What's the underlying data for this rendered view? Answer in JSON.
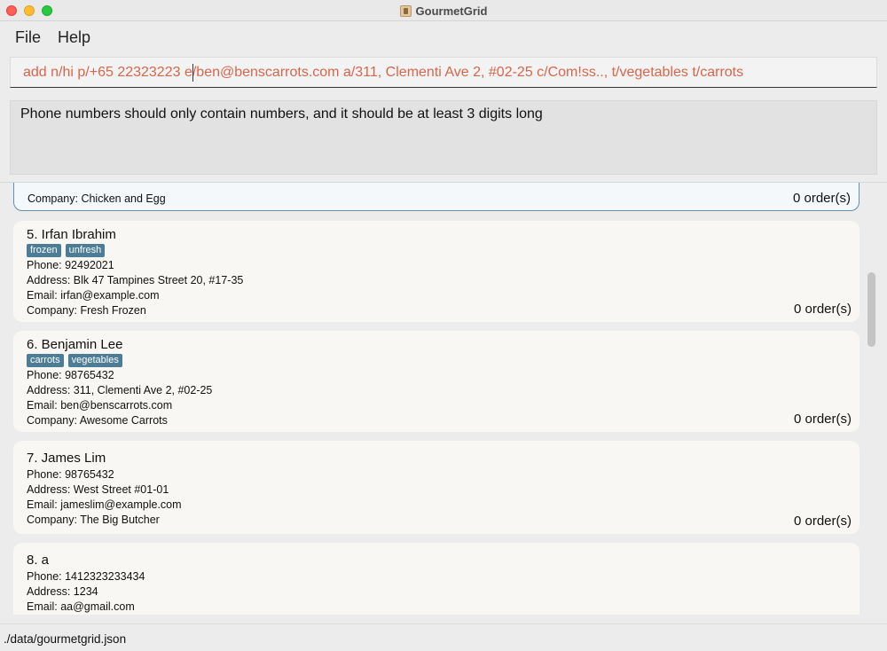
{
  "window": {
    "title": "GourmetGrid"
  },
  "menu": {
    "file": "File",
    "help": "Help"
  },
  "command": {
    "value": "add n/hi p/+65 22323223 e/ben@benscarrots.com a/311, Clementi Ave 2, #02-25 c/Com!ss.., t/vegetables t/carrots"
  },
  "result": {
    "message": "Phone numbers should only contain numbers, and it should be at least 3 digits long"
  },
  "contacts": {
    "c4": {
      "company": "Company: Chicken and Egg",
      "orders": "0 order(s)"
    },
    "c5": {
      "name": "5.  Irfan Ibrahim",
      "tags": [
        "frozen",
        "unfresh"
      ],
      "phone": "Phone: 92492021",
      "address": "Address: Blk 47 Tampines Street 20, #17-35",
      "email": "Email: irfan@example.com",
      "company": "Company: Fresh Frozen",
      "orders": "0 order(s)"
    },
    "c6": {
      "name": "6.  Benjamin Lee",
      "tags": [
        "carrots",
        "vegetables"
      ],
      "phone": "Phone: 98765432",
      "address": "Address: 311, Clementi Ave 2, #02-25",
      "email": "Email: ben@benscarrots.com",
      "company": "Company: Awesome Carrots",
      "orders": "0 order(s)"
    },
    "c7": {
      "name": "7.  James Lim",
      "phone": "Phone: 98765432",
      "address": "Address: West Street #01-01",
      "email": "Email: jameslim@example.com",
      "company": "Company: The Big Butcher",
      "orders": "0 order(s)"
    },
    "c8": {
      "name": "8.  a",
      "phone": "Phone: 1412323233434",
      "address": "Address: 1234",
      "email": "Email: aa@gmail.com"
    }
  },
  "status": {
    "file_path": "./data/gourmetgrid.json"
  },
  "colors": {
    "command_text": "#d9664c",
    "tag_bg": "#4d7d96",
    "selected_border": "#5d8fb0"
  }
}
